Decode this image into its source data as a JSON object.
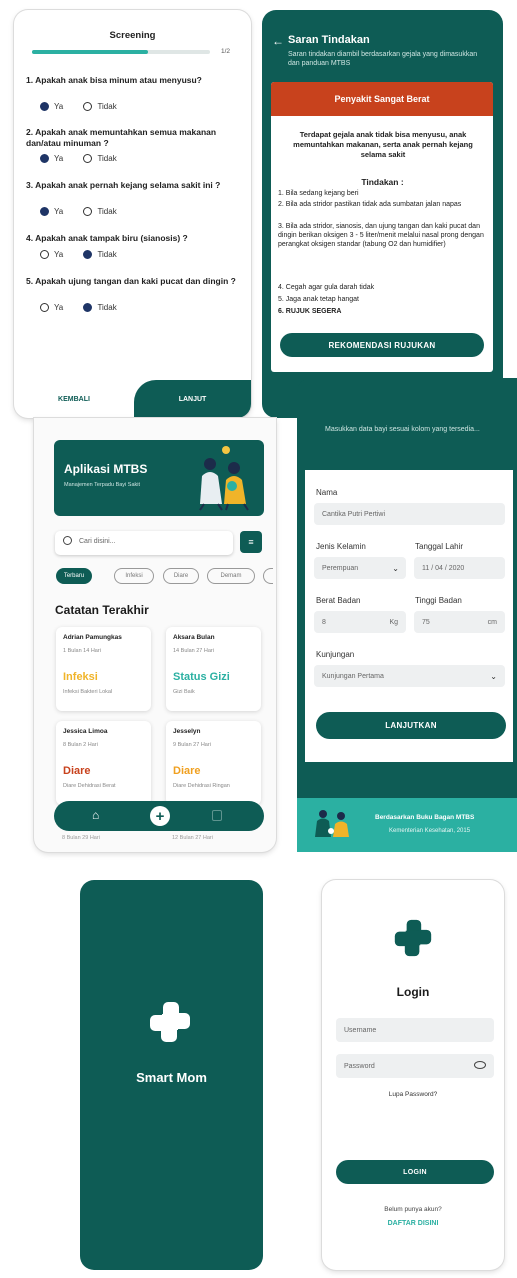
{
  "screening": {
    "title": "Screening",
    "progress_text": "1/2",
    "progress_fraction": 0.65,
    "questions": [
      {
        "text": "1. Apakah anak bisa minum atau menyusu?",
        "yes": "Ya",
        "no": "Tidak",
        "selected": "yes"
      },
      {
        "text": "2. Apakah anak memuntahkan semua makanan dan/atau minuman ?",
        "yes": "Ya",
        "no": "Tidak",
        "selected": "yes"
      },
      {
        "text": "3. Apakah anak pernah kejang selama sakit ini ?",
        "yes": "Ya",
        "no": "Tidak",
        "selected": "yes"
      },
      {
        "text": "4. Apakah anak tampak biru (sianosis) ?",
        "yes": "Ya",
        "no": "Tidak",
        "selected": "no"
      },
      {
        "text": "5. Apakah ujung tangan dan kaki pucat dan dingin ?",
        "yes": "Ya",
        "no": "Tidak",
        "selected": "no"
      }
    ],
    "back_label": "KEMBALI",
    "next_label": "LANJUT"
  },
  "saran": {
    "title": "Saran Tindakan",
    "subtitle": "Saran tindakan diambil berdasarkan gejala yang dimasukkan dan panduan MTBS",
    "banner": "Penyakit Sangat Berat",
    "summary": "Terdapat gejala anak tidak bisa menyusu, anak memuntahkan makanan, serta anak pernah kejang selama sakit",
    "tindakan_title": "Tindakan :",
    "items": [
      "1. Bila sedang kejang beri",
      "2. Bila ada stridor pastikan tidak ada sumbatan jalan napas",
      "3. Bila ada stridor, sianosis, dan ujung tangan dan kaki pucat dan dingin berikan oksigen 3 - 5 liter/menit melalui nasal prong dengan perangkat oksigen standar (tabung O2 dan humidifier)",
      "4. Cegah agar gula darah tidak",
      "5. Jaga anak tetap hangat",
      "6. RUJUK SEGERA"
    ],
    "button": "REKOMENDASI RUJUKAN",
    "banner_color": "#c8421d"
  },
  "home": {
    "title": "Aplikasi MTBS",
    "subtitle": "Manajemen Terpadu Bayi Sakit",
    "search_placeholder": "Cari disini...",
    "chips": [
      "Terbaru",
      "Infeksi",
      "Diare",
      "Demam"
    ],
    "section_title": "Catatan Terakhir",
    "cards": [
      {
        "name": "Adrian Pamungkas",
        "age": "1 Bulan 14 Hari",
        "diagnosis": "Infeksi",
        "detail": "Infeksi Bakteri Lokal",
        "color": "#f0b429"
      },
      {
        "name": "Aksara Bulan",
        "age": "14 Bulan 27 Hari",
        "diagnosis": "Status Gizi",
        "detail": "Gizi Baik",
        "color": "#2bb0a2"
      },
      {
        "name": "Jessica Limoa",
        "age": "8 Bulan 2 Hari",
        "diagnosis": "Diare",
        "detail": "Diare Dehidrasi Berat",
        "color": "#c8421d"
      },
      {
        "name": "Jesselyn",
        "age": "9 Bulan 27 Hari",
        "diagnosis": "Diare",
        "detail": "Diare Dehidrasi Ringan",
        "color": "#f0a020"
      }
    ],
    "bottom_row_left": "8 Bulan 29 Hari",
    "bottom_row_right": "12 Bulan 27 Hari"
  },
  "form": {
    "intro": "Masukkan data bayi sesuai kolom yang tersedia...",
    "name_label": "Nama",
    "name_value": "Cantika Putri Pertiwi",
    "gender_label": "Jenis Kelamin",
    "gender_value": "Perempuan",
    "dob_label": "Tanggal Lahir",
    "dob_value": "11 / 04 / 2020",
    "weight_label": "Berat Badan",
    "weight_value": "8",
    "weight_unit": "Kg",
    "height_label": "Tinggi Badan",
    "height_value": "75",
    "height_unit": "cm",
    "visit_label": "Kunjungan",
    "visit_value": "Kunjungan Pertama",
    "button": "LANJUTKAN",
    "footer_title": "Berdasarkan Buku Bagan MTBS",
    "footer_sub": "Kementerian Kesehatan, 2015"
  },
  "splash": {
    "app_name": "Smart Mom"
  },
  "login": {
    "title": "Login",
    "username_placeholder": "Username",
    "password_placeholder": "Password",
    "forgot": "Lupa Password?",
    "button": "LOGIN",
    "no_account": "Belum punya akun?",
    "register": "DAFTAR DISINI"
  },
  "colors": {
    "primary": "#0e5c55",
    "accent_red": "#c8421d"
  }
}
